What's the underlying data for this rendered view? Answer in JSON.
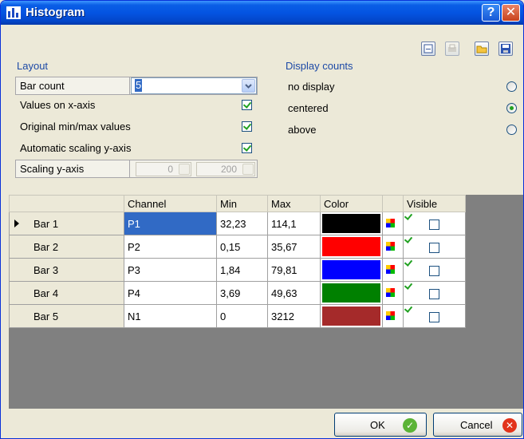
{
  "window": {
    "title": "Histogram",
    "help_label": "?",
    "close_label": "✕"
  },
  "layout": {
    "section_title": "Layout",
    "bar_count_label": "Bar count",
    "bar_count_value": "5",
    "values_on_x_label": "Values on x-axis",
    "values_on_x_checked": true,
    "orig_minmax_label": "Original min/max values",
    "orig_minmax_checked": true,
    "auto_scaling_label": "Automatic scaling y-axis",
    "auto_scaling_checked": true,
    "scaling_label": "Scaling y-axis",
    "scaling_min": "0",
    "scaling_max": "200"
  },
  "display_counts": {
    "section_title": "Display counts",
    "options": [
      "no display",
      "centered",
      "above"
    ],
    "selected": "centered"
  },
  "toolbar": {
    "icons": [
      "options-icon",
      "print-icon",
      "open-folder-icon",
      "save-icon"
    ]
  },
  "grid": {
    "columns": [
      "",
      "Channel",
      "Min",
      "Max",
      "Color",
      "",
      "Visible"
    ],
    "rows": [
      {
        "label": "Bar 1",
        "channel": "P1",
        "min": "32,23",
        "max": "114,1",
        "color": "#000000",
        "visible": true,
        "current": true
      },
      {
        "label": "Bar 2",
        "channel": "P2",
        "min": "0,15",
        "max": "35,67",
        "color": "#ff0000",
        "visible": true
      },
      {
        "label": "Bar 3",
        "channel": "P3",
        "min": "1,84",
        "max": "79,81",
        "color": "#0000ff",
        "visible": true
      },
      {
        "label": "Bar 4",
        "channel": "P4",
        "min": "3,69",
        "max": "49,63",
        "color": "#008000",
        "visible": true
      },
      {
        "label": "Bar 5",
        "channel": "N1",
        "min": "0",
        "max": "3212",
        "color": "#a52a2a",
        "visible": true
      }
    ]
  },
  "buttons": {
    "ok_label": "OK",
    "cancel_label": "Cancel"
  }
}
